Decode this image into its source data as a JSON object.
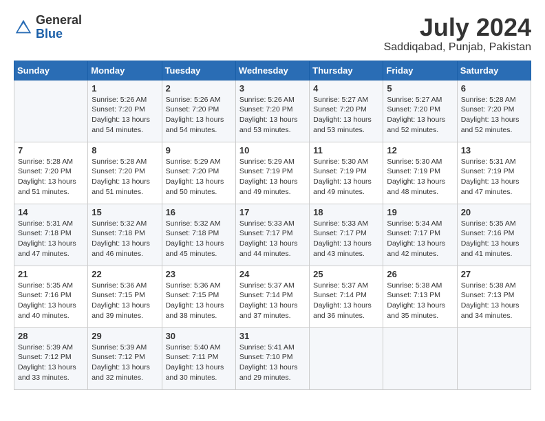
{
  "header": {
    "logo_line1": "General",
    "logo_line2": "Blue",
    "month_year": "July 2024",
    "location": "Saddiqabad, Punjab, Pakistan"
  },
  "weekdays": [
    "Sunday",
    "Monday",
    "Tuesday",
    "Wednesday",
    "Thursday",
    "Friday",
    "Saturday"
  ],
  "weeks": [
    [
      {
        "day": "",
        "sunrise": "",
        "sunset": "",
        "daylight": ""
      },
      {
        "day": "1",
        "sunrise": "5:26 AM",
        "sunset": "7:20 PM",
        "daylight": "13 hours and 54 minutes."
      },
      {
        "day": "2",
        "sunrise": "5:26 AM",
        "sunset": "7:20 PM",
        "daylight": "13 hours and 54 minutes."
      },
      {
        "day": "3",
        "sunrise": "5:26 AM",
        "sunset": "7:20 PM",
        "daylight": "13 hours and 53 minutes."
      },
      {
        "day": "4",
        "sunrise": "5:27 AM",
        "sunset": "7:20 PM",
        "daylight": "13 hours and 53 minutes."
      },
      {
        "day": "5",
        "sunrise": "5:27 AM",
        "sunset": "7:20 PM",
        "daylight": "13 hours and 52 minutes."
      },
      {
        "day": "6",
        "sunrise": "5:28 AM",
        "sunset": "7:20 PM",
        "daylight": "13 hours and 52 minutes."
      }
    ],
    [
      {
        "day": "7",
        "sunrise": "5:28 AM",
        "sunset": "7:20 PM",
        "daylight": "13 hours and 51 minutes."
      },
      {
        "day": "8",
        "sunrise": "5:28 AM",
        "sunset": "7:20 PM",
        "daylight": "13 hours and 51 minutes."
      },
      {
        "day": "9",
        "sunrise": "5:29 AM",
        "sunset": "7:20 PM",
        "daylight": "13 hours and 50 minutes."
      },
      {
        "day": "10",
        "sunrise": "5:29 AM",
        "sunset": "7:19 PM",
        "daylight": "13 hours and 49 minutes."
      },
      {
        "day": "11",
        "sunrise": "5:30 AM",
        "sunset": "7:19 PM",
        "daylight": "13 hours and 49 minutes."
      },
      {
        "day": "12",
        "sunrise": "5:30 AM",
        "sunset": "7:19 PM",
        "daylight": "13 hours and 48 minutes."
      },
      {
        "day": "13",
        "sunrise": "5:31 AM",
        "sunset": "7:19 PM",
        "daylight": "13 hours and 47 minutes."
      }
    ],
    [
      {
        "day": "14",
        "sunrise": "5:31 AM",
        "sunset": "7:18 PM",
        "daylight": "13 hours and 47 minutes."
      },
      {
        "day": "15",
        "sunrise": "5:32 AM",
        "sunset": "7:18 PM",
        "daylight": "13 hours and 46 minutes."
      },
      {
        "day": "16",
        "sunrise": "5:32 AM",
        "sunset": "7:18 PM",
        "daylight": "13 hours and 45 minutes."
      },
      {
        "day": "17",
        "sunrise": "5:33 AM",
        "sunset": "7:17 PM",
        "daylight": "13 hours and 44 minutes."
      },
      {
        "day": "18",
        "sunrise": "5:33 AM",
        "sunset": "7:17 PM",
        "daylight": "13 hours and 43 minutes."
      },
      {
        "day": "19",
        "sunrise": "5:34 AM",
        "sunset": "7:17 PM",
        "daylight": "13 hours and 42 minutes."
      },
      {
        "day": "20",
        "sunrise": "5:35 AM",
        "sunset": "7:16 PM",
        "daylight": "13 hours and 41 minutes."
      }
    ],
    [
      {
        "day": "21",
        "sunrise": "5:35 AM",
        "sunset": "7:16 PM",
        "daylight": "13 hours and 40 minutes."
      },
      {
        "day": "22",
        "sunrise": "5:36 AM",
        "sunset": "7:15 PM",
        "daylight": "13 hours and 39 minutes."
      },
      {
        "day": "23",
        "sunrise": "5:36 AM",
        "sunset": "7:15 PM",
        "daylight": "13 hours and 38 minutes."
      },
      {
        "day": "24",
        "sunrise": "5:37 AM",
        "sunset": "7:14 PM",
        "daylight": "13 hours and 37 minutes."
      },
      {
        "day": "25",
        "sunrise": "5:37 AM",
        "sunset": "7:14 PM",
        "daylight": "13 hours and 36 minutes."
      },
      {
        "day": "26",
        "sunrise": "5:38 AM",
        "sunset": "7:13 PM",
        "daylight": "13 hours and 35 minutes."
      },
      {
        "day": "27",
        "sunrise": "5:38 AM",
        "sunset": "7:13 PM",
        "daylight": "13 hours and 34 minutes."
      }
    ],
    [
      {
        "day": "28",
        "sunrise": "5:39 AM",
        "sunset": "7:12 PM",
        "daylight": "13 hours and 33 minutes."
      },
      {
        "day": "29",
        "sunrise": "5:39 AM",
        "sunset": "7:12 PM",
        "daylight": "13 hours and 32 minutes."
      },
      {
        "day": "30",
        "sunrise": "5:40 AM",
        "sunset": "7:11 PM",
        "daylight": "13 hours and 30 minutes."
      },
      {
        "day": "31",
        "sunrise": "5:41 AM",
        "sunset": "7:10 PM",
        "daylight": "13 hours and 29 minutes."
      },
      {
        "day": "",
        "sunrise": "",
        "sunset": "",
        "daylight": ""
      },
      {
        "day": "",
        "sunrise": "",
        "sunset": "",
        "daylight": ""
      },
      {
        "day": "",
        "sunrise": "",
        "sunset": "",
        "daylight": ""
      }
    ]
  ]
}
